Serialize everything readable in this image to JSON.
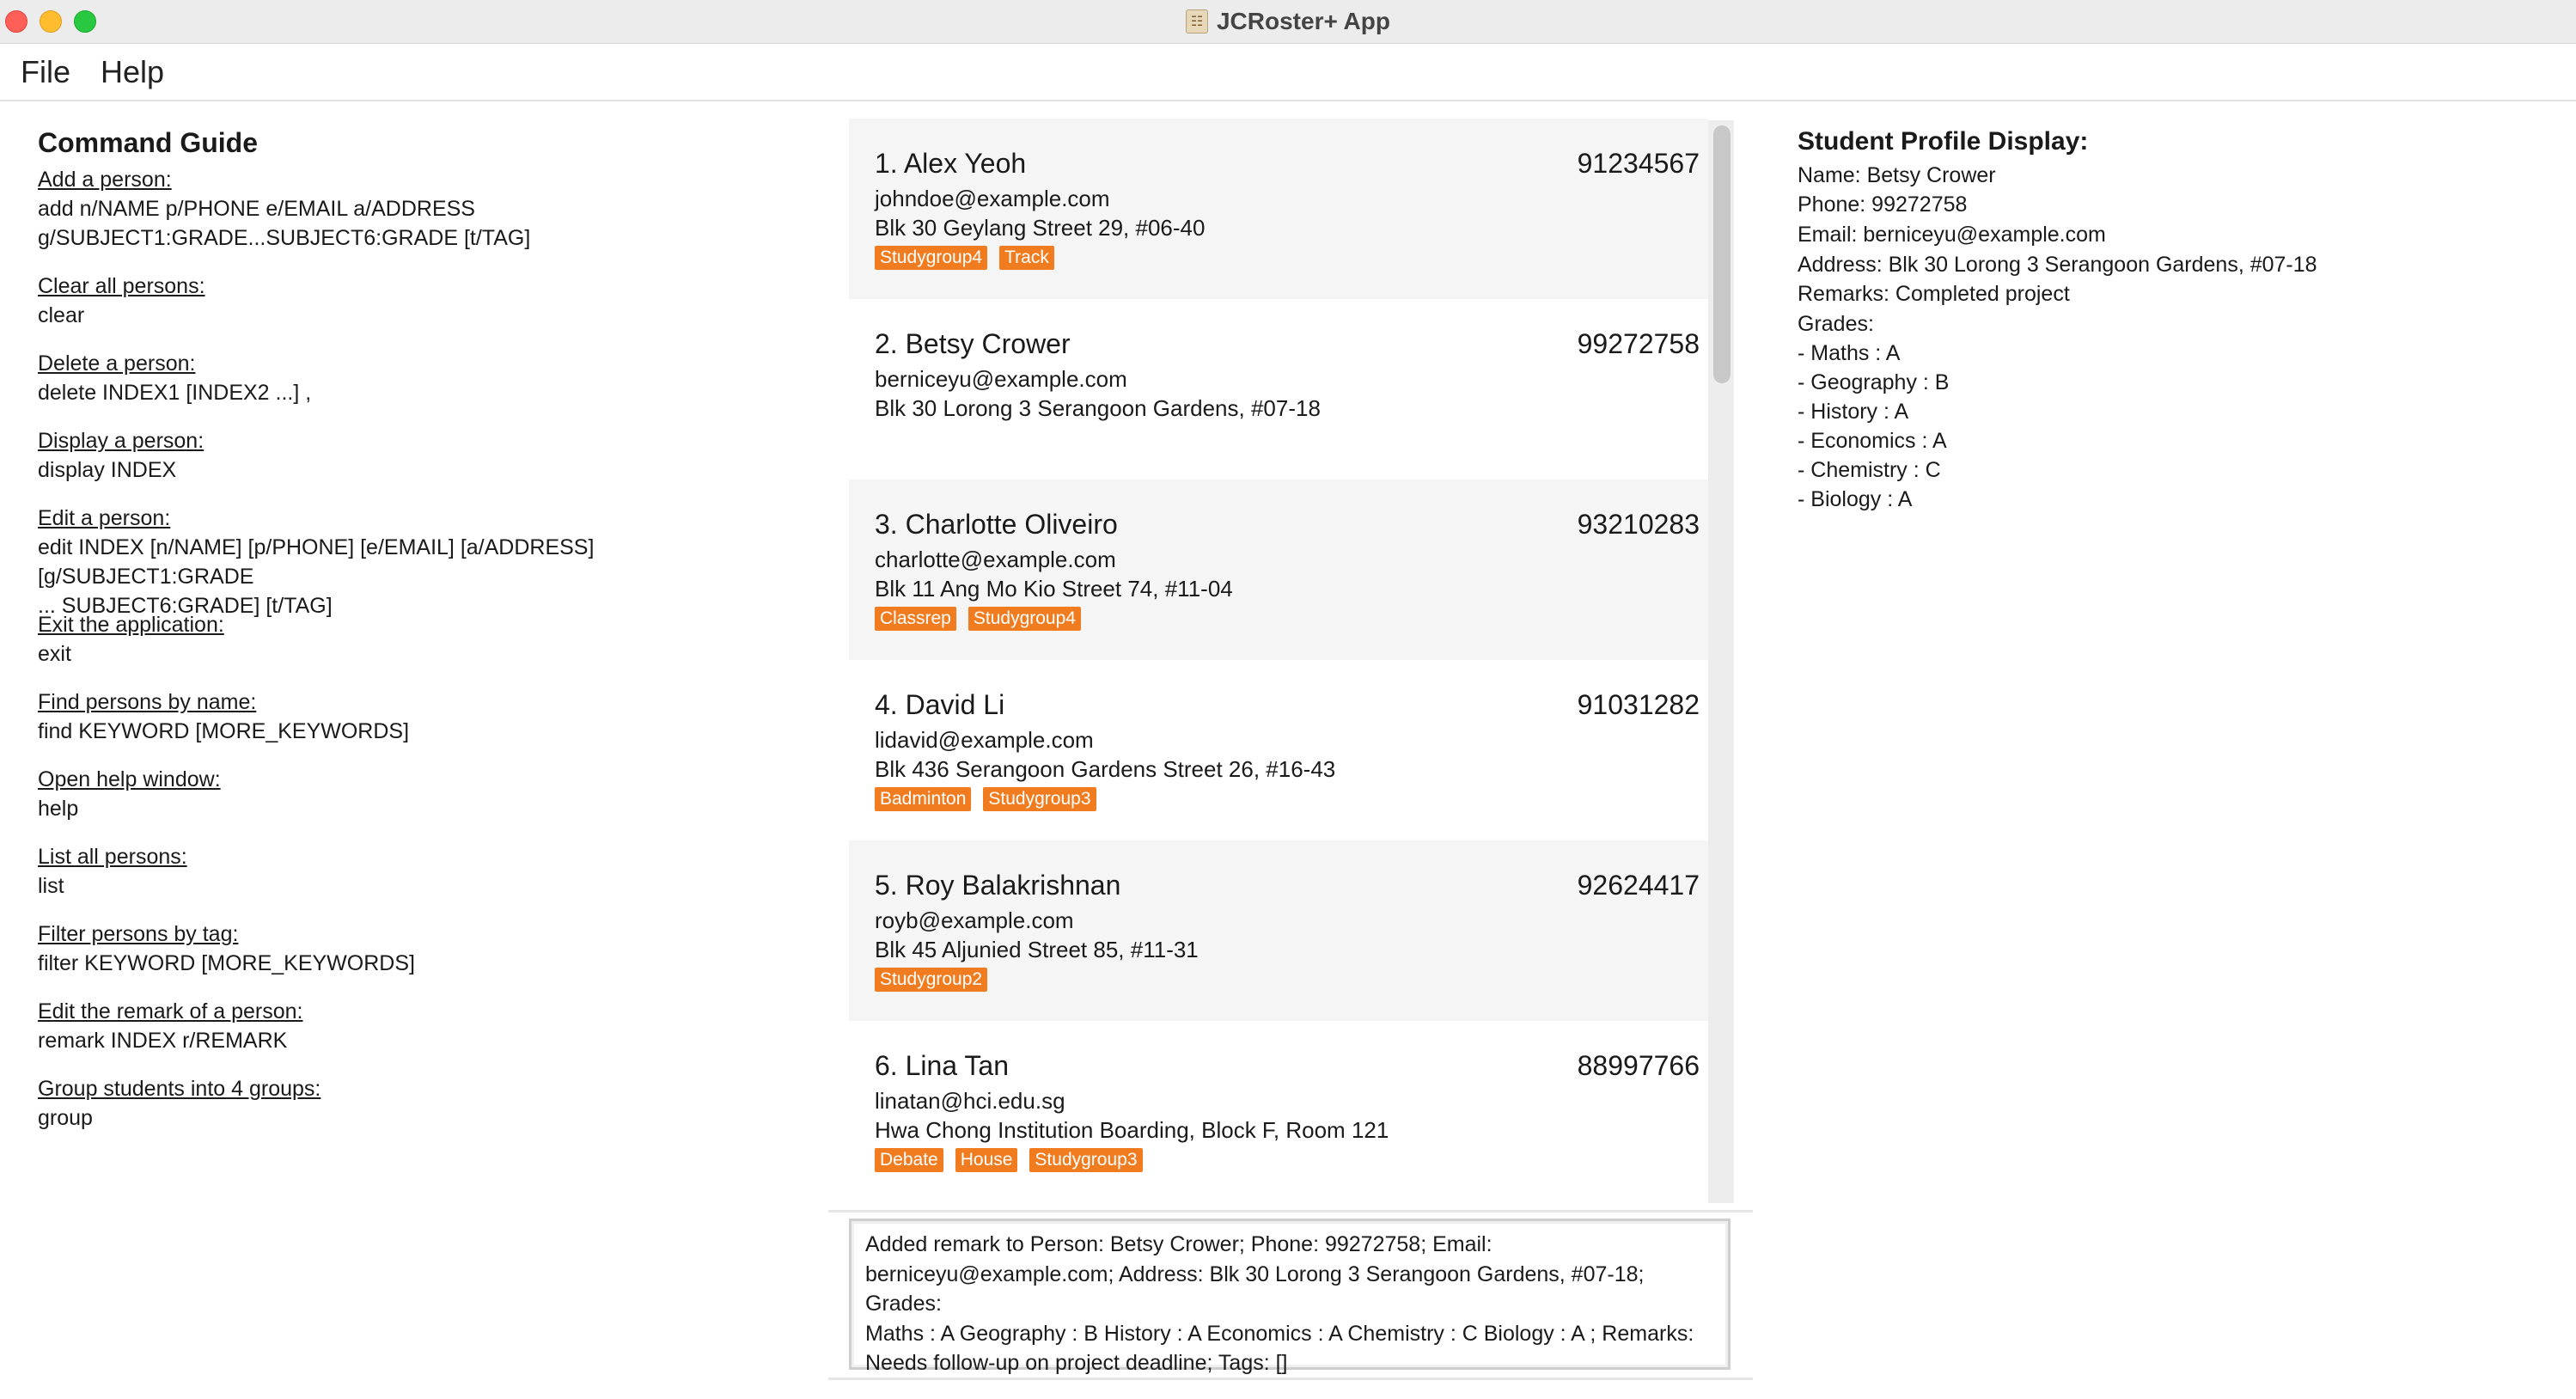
{
  "window": {
    "title": "JCRoster+ App",
    "icon": "app-icon",
    "colors": {
      "close": "#fe5f57",
      "minimize": "#febc2e",
      "maximize": "#28c840"
    }
  },
  "menu": {
    "file": "File",
    "help": "Help"
  },
  "guide": {
    "title": "Command Guide",
    "entries": [
      {
        "label": "Add a person:",
        "cmd": "add n/NAME p/PHONE e/EMAIL a/ADDRESS\ng/SUBJECT1:GRADE...SUBJECT6:GRADE [t/TAG]"
      },
      {
        "label": "Clear all persons:",
        "cmd": "clear"
      },
      {
        "label": "Delete a person:",
        "cmd": "delete INDEX1 [INDEX2 ...] ,"
      },
      {
        "label": "Display a person:",
        "cmd": "display INDEX"
      },
      {
        "label": "Edit a person:",
        "cmd": "edit INDEX [n/NAME] [p/PHONE] [e/EMAIL] [a/ADDRESS] [g/SUBJECT1:GRADE\n... SUBJECT6:GRADE] [t/TAG]"
      },
      {
        "label": "Exit the application:",
        "cmd": "exit"
      },
      {
        "label": "Find persons by name:",
        "cmd": "find KEYWORD [MORE_KEYWORDS]"
      },
      {
        "label": "Open help window:",
        "cmd": "help"
      },
      {
        "label": "List all persons:",
        "cmd": "list"
      },
      {
        "label": "Filter persons by tag:",
        "cmd": "filter KEYWORD [MORE_KEYWORDS]"
      },
      {
        "label": "Edit the remark of a person:",
        "cmd": "remark INDEX r/REMARK"
      },
      {
        "label": "Group students into 4 groups:",
        "cmd": "group"
      }
    ]
  },
  "persons": [
    {
      "name": "1. Alex Yeoh",
      "phone": "91234567",
      "email": "johndoe@example.com",
      "address": "Blk 30 Geylang Street 29, #06-40",
      "tags": [
        "Studygroup4",
        "Track"
      ]
    },
    {
      "name": "2. Betsy Crower",
      "phone": "99272758",
      "email": "berniceyu@example.com",
      "address": "Blk 30 Lorong 3 Serangoon Gardens, #07-18",
      "tags": []
    },
    {
      "name": "3. Charlotte Oliveiro",
      "phone": "93210283",
      "email": "charlotte@example.com",
      "address": "Blk 11 Ang Mo Kio Street 74, #11-04",
      "tags": [
        "Classrep",
        "Studygroup4"
      ]
    },
    {
      "name": "4. David Li",
      "phone": "91031282",
      "email": "lidavid@example.com",
      "address": "Blk 436 Serangoon Gardens Street 26, #16-43",
      "tags": [
        "Badminton",
        "Studygroup3"
      ]
    },
    {
      "name": "5. Roy Balakrishnan",
      "phone": "92624417",
      "email": "royb@example.com",
      "address": "Blk 45 Aljunied Street 85, #11-31",
      "tags": [
        "Studygroup2"
      ]
    },
    {
      "name": "6. Lina Tan",
      "phone": "88997766",
      "email": "linatan@hci.edu.sg",
      "address": "Hwa Chong Institution Boarding, Block F, Room 121",
      "tags": [
        "Debate",
        "House",
        "Studygroup3"
      ]
    }
  ],
  "tag_color": "#f07c1f",
  "result": {
    "lines": [
      "Added remark to Person: Betsy Crower; Phone: 99272758; Email:",
      "berniceyu@example.com; Address: Blk 30 Lorong 3 Serangoon Gardens, #07-18; Grades:",
      "Maths : A Geography : B History : A Economics : A Chemistry : C Biology : A ; Remarks:",
      "Needs follow-up on project deadline; Tags: []"
    ]
  },
  "profile": {
    "title": "Student Profile Display:",
    "lines": [
      "Name: Betsy Crower",
      "Phone: 99272758",
      "Email: berniceyu@example.com",
      "Address: Blk 30 Lorong 3 Serangoon Gardens, #07-18",
      "Remarks: Completed project",
      "Grades:",
      "- Maths : A",
      "- Geography : B",
      "- History : A",
      "- Economics : A",
      "- Chemistry : C",
      "- Biology : A"
    ]
  }
}
